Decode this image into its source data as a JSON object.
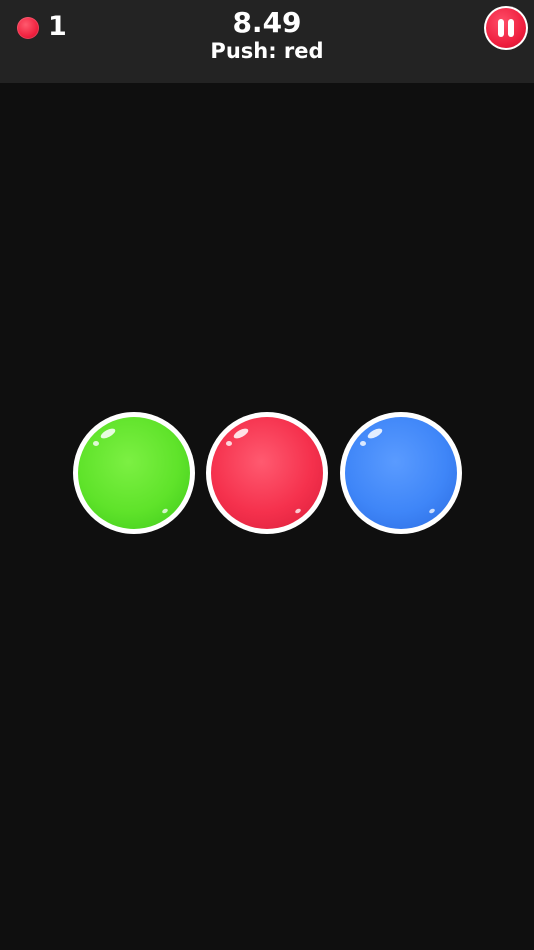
{
  "hud": {
    "score": "1",
    "score_icon": "red-dot-icon",
    "timer": "8.49",
    "instruction": "Push: red",
    "pause_icon": "pause-icon"
  },
  "bubbles": [
    {
      "color_name": "green",
      "color": "#5fe32a"
    },
    {
      "color_name": "red",
      "color": "#f5314d"
    },
    {
      "color_name": "blue",
      "color": "#3f86f8"
    }
  ],
  "colors": {
    "background": "#0f0f0f",
    "topbar": "#232323",
    "accent_red": "#ee1d3d"
  }
}
